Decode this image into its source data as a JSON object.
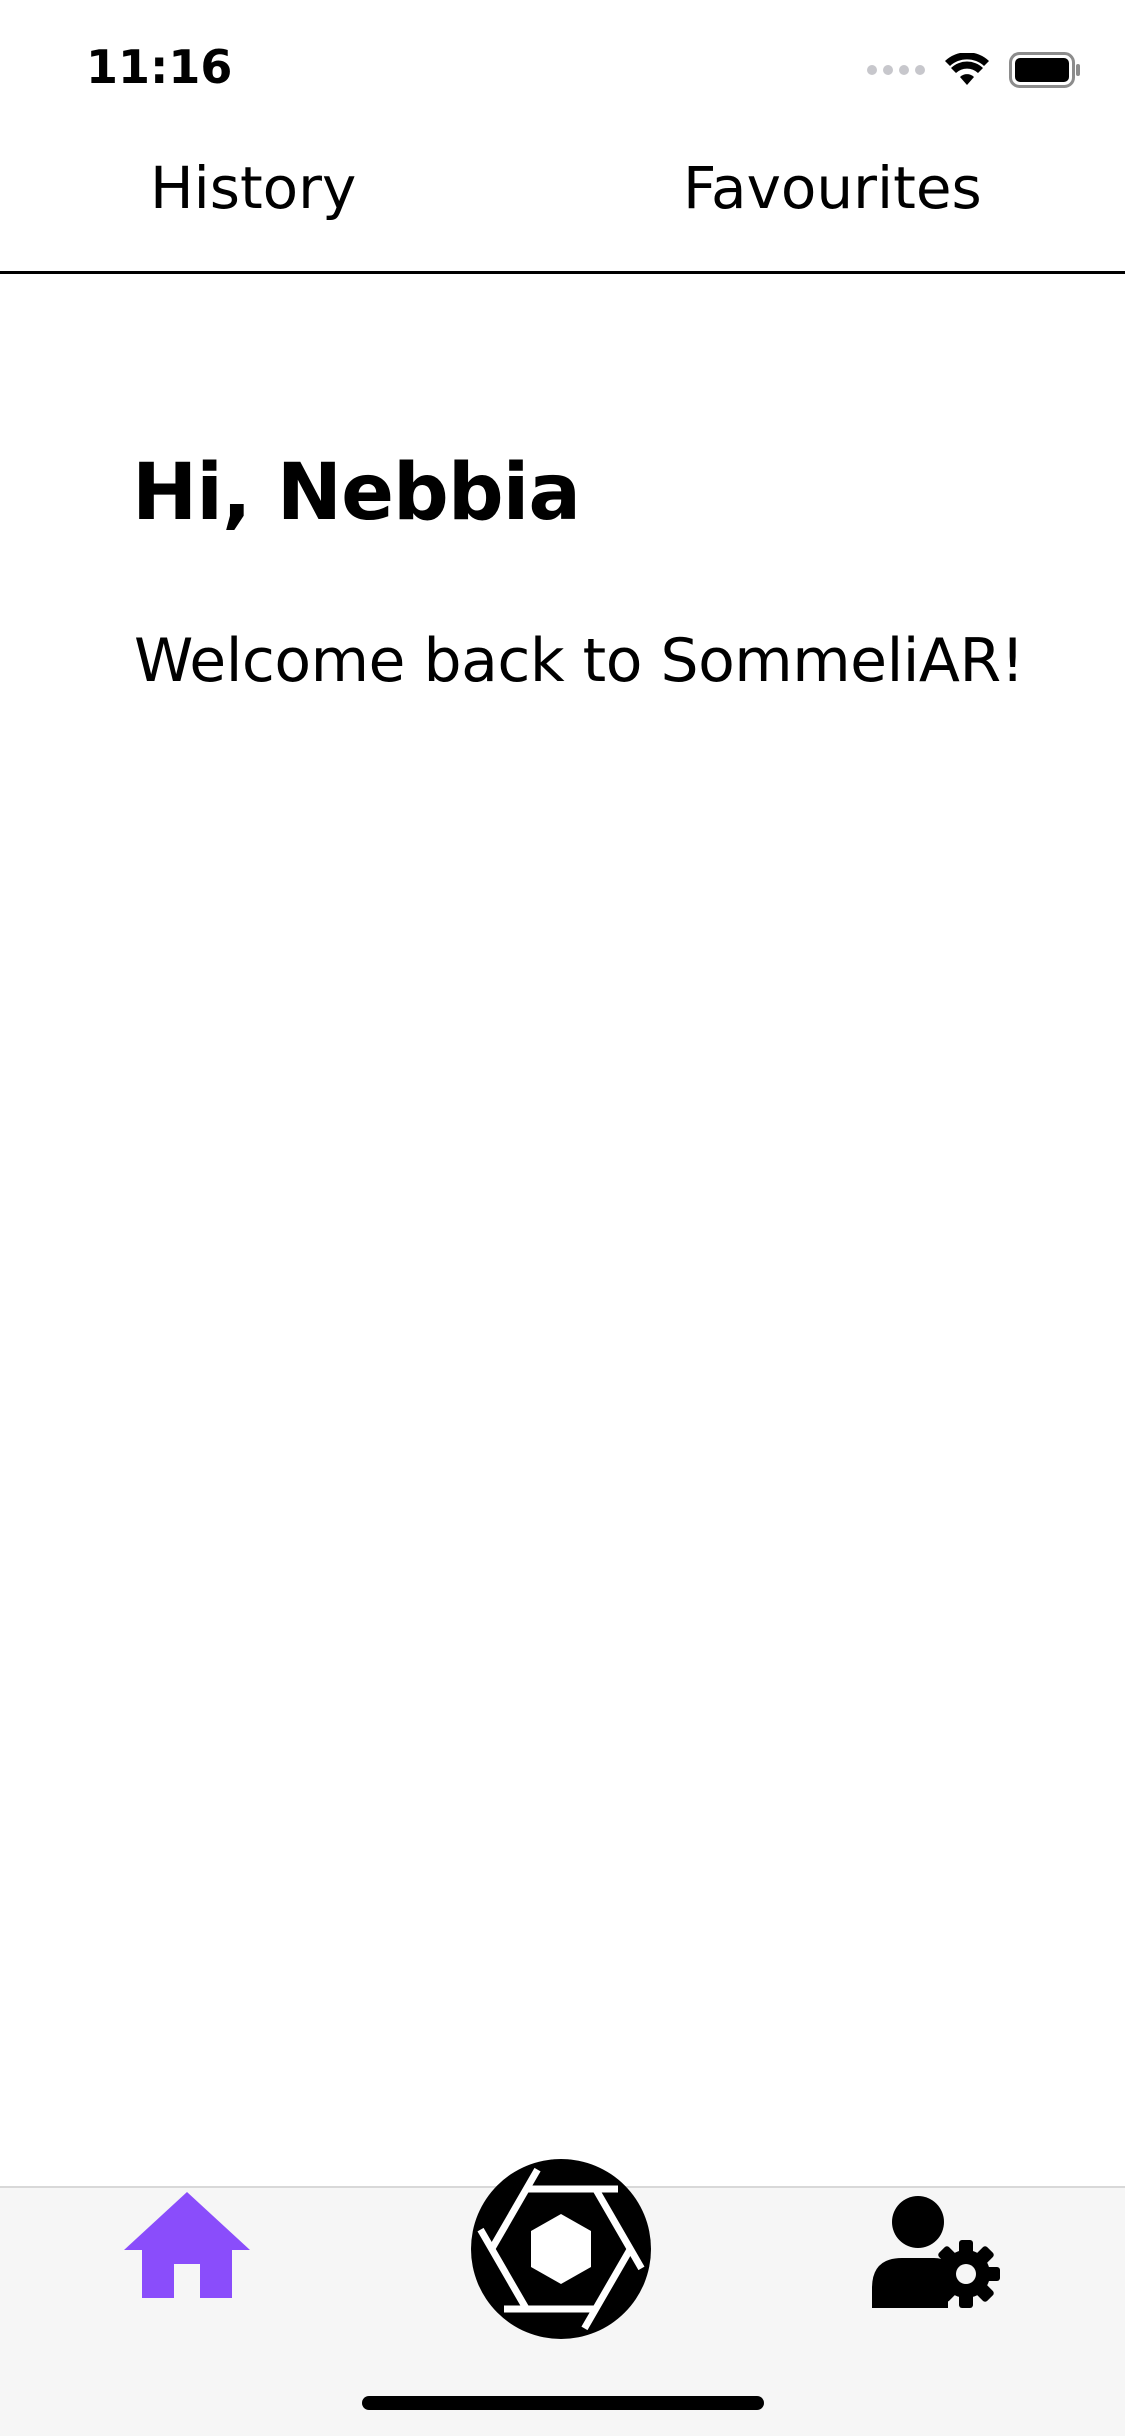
{
  "status_bar": {
    "time": "11:16",
    "icons": [
      "cellular-signal-icon",
      "wifi-icon",
      "battery-icon"
    ]
  },
  "top_tabs": [
    {
      "label": "History"
    },
    {
      "label": "Favourites"
    }
  ],
  "main": {
    "greeting": "Hi, Nebbia",
    "welcome": "Welcome back to SommeliAR!"
  },
  "bottom_nav": {
    "items": [
      {
        "icon": "home-icon",
        "active": true
      },
      {
        "icon": "camera-shutter-icon",
        "active": false
      },
      {
        "icon": "user-settings-icon",
        "active": false
      }
    ],
    "active_color": "#8a4dfb",
    "inactive_color": "#000000"
  }
}
